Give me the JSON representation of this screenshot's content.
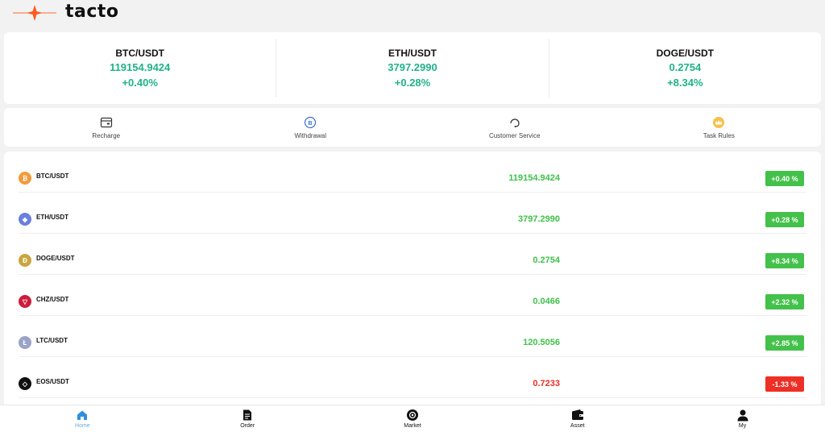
{
  "brand": {
    "name": "tacto",
    "accent": "#ff6a2a"
  },
  "tickers": [
    {
      "pair": "BTC/USDT",
      "price": "119154.9424",
      "change": "+0.40%"
    },
    {
      "pair": "ETH/USDT",
      "price": "3797.2990",
      "change": "+0.28%"
    },
    {
      "pair": "DOGE/USDT",
      "price": "0.2754",
      "change": "+8.34%"
    }
  ],
  "actions": [
    {
      "label": "Recharge",
      "icon": "wallet-card-icon"
    },
    {
      "label": "Withdrawal",
      "icon": "coin-withdraw-icon"
    },
    {
      "label": "Customer Service",
      "icon": "headset-icon"
    },
    {
      "label": "Task Rules",
      "icon": "crown-icon"
    }
  ],
  "market": [
    {
      "pair": "BTC/USDT",
      "price": "119154.9424",
      "change": "+0.40 %",
      "trend": "up",
      "icon": "bitcoin-icon",
      "color": "#f39a3b",
      "glyph": "₿"
    },
    {
      "pair": "ETH/USDT",
      "price": "3797.2990",
      "change": "+0.28 %",
      "trend": "up",
      "icon": "ethereum-icon",
      "color": "#6b7fe0",
      "glyph": "◆"
    },
    {
      "pair": "DOGE/USDT",
      "price": "0.2754",
      "change": "+8.34 %",
      "trend": "up",
      "icon": "dogecoin-icon",
      "color": "#c9a640",
      "glyph": "Ð"
    },
    {
      "pair": "CHZ/USDT",
      "price": "0.0466",
      "change": "+2.32 %",
      "trend": "up",
      "icon": "chiliz-icon",
      "color": "#cd1c3c",
      "glyph": "▽"
    },
    {
      "pair": "LTC/USDT",
      "price": "120.5056",
      "change": "+2.85 %",
      "trend": "up",
      "icon": "litecoin-icon",
      "color": "#9aa3c8",
      "glyph": "Ł"
    },
    {
      "pair": "EOS/USDT",
      "price": "0.7233",
      "change": "-1.33 %",
      "trend": "down",
      "icon": "eos-icon",
      "color": "#111111",
      "glyph": "◇"
    }
  ],
  "tabs": [
    {
      "label": "Home",
      "icon": "home-icon",
      "active": true
    },
    {
      "label": "Order",
      "icon": "document-icon",
      "active": false
    },
    {
      "label": "Market",
      "icon": "market-icon",
      "active": false
    },
    {
      "label": "Asset",
      "icon": "wallet-icon",
      "active": false
    },
    {
      "label": "My",
      "icon": "user-icon",
      "active": false
    }
  ]
}
